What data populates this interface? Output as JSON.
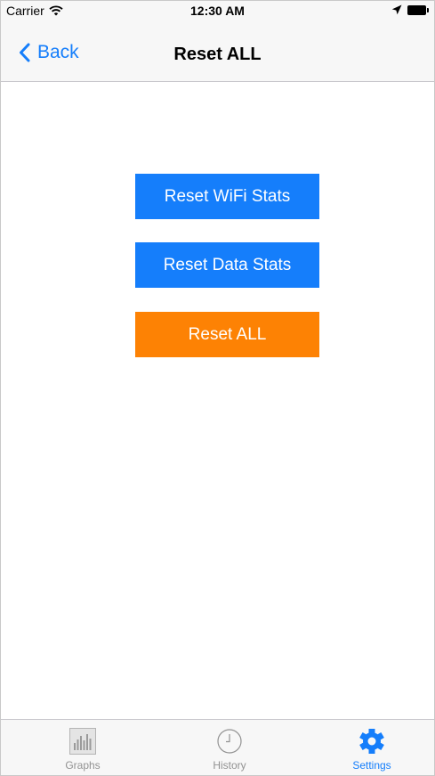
{
  "status_bar": {
    "carrier": "Carrier",
    "time": "12:30 AM",
    "icons": [
      "wifi-icon",
      "location-arrow-icon",
      "battery-icon"
    ]
  },
  "nav": {
    "back_label": "Back",
    "title": "Reset ALL"
  },
  "buttons": [
    {
      "label": "Reset WiFi Stats",
      "color": "#157efb"
    },
    {
      "label": "Reset Data Stats",
      "color": "#157efb"
    },
    {
      "label": "Reset ALL",
      "color": "#fd8204"
    }
  ],
  "tab_bar": {
    "tabs": [
      {
        "label": "Graphs",
        "icon": "bar-graph-icon",
        "active": false
      },
      {
        "label": "History",
        "icon": "clock-icon",
        "active": false
      },
      {
        "label": "Settings",
        "icon": "gear-icon",
        "active": true
      }
    ]
  },
  "colors": {
    "accent": "#157efb",
    "danger": "#fd8204",
    "bar_background": "#f7f7f7",
    "inactive_tab": "#929292"
  }
}
